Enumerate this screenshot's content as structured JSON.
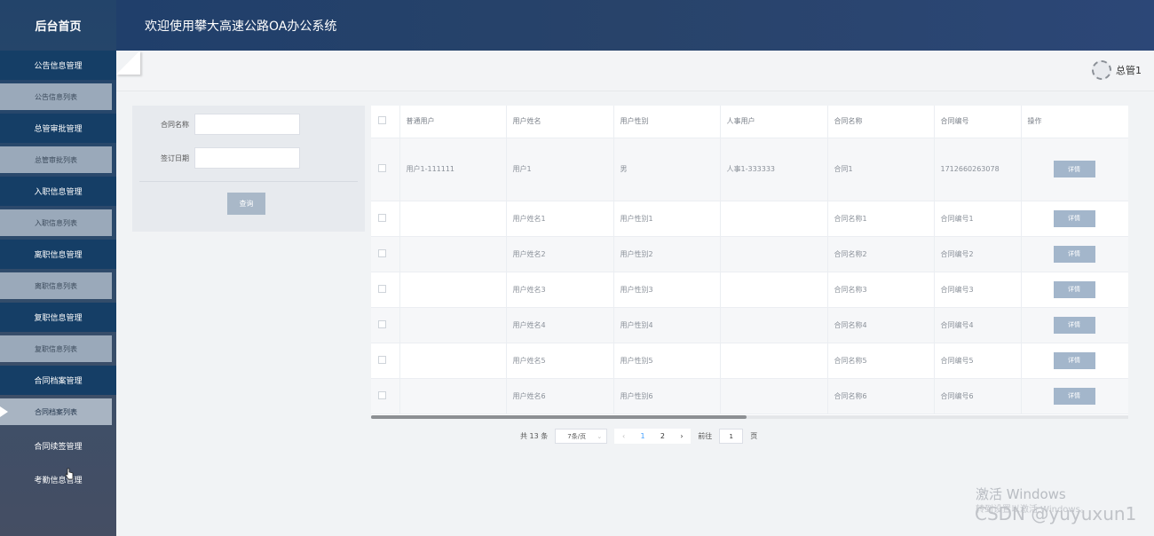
{
  "sidebar": {
    "title": "后台首页",
    "items": [
      {
        "section": "公告信息管理",
        "sub": "公告信息列表"
      },
      {
        "section": "总管审批管理",
        "sub": "总管审批列表"
      },
      {
        "section": "入职信息管理",
        "sub": "入职信息列表"
      },
      {
        "section": "离职信息管理",
        "sub": "离职信息列表"
      },
      {
        "section": "复职信息管理",
        "sub": "复职信息列表"
      },
      {
        "section": "合同档案管理",
        "sub": "合同档案列表"
      }
    ],
    "plain_items": [
      "合同续签管理",
      "考勤信息管理"
    ]
  },
  "header": {
    "title": "欢迎使用攀大高速公路OA办公系统"
  },
  "user": {
    "name": "总管1"
  },
  "search": {
    "contract_name_label": "合同名称",
    "sign_date_label": "签订日期",
    "query_button": "查询"
  },
  "table": {
    "columns": [
      "普通用户",
      "用户姓名",
      "用户性别",
      "人事用户",
      "合同名称",
      "合同编号",
      "操作"
    ],
    "rows": [
      {
        "normal_user": "用户1-111111",
        "name": "用户1",
        "gender": "男",
        "hr_user": "人事1-333333",
        "contract_name": "合同1",
        "contract_no": "1712660263078",
        "action": "详情"
      },
      {
        "normal_user": "",
        "name": "用户姓名1",
        "gender": "用户性别1",
        "hr_user": "",
        "contract_name": "合同名称1",
        "contract_no": "合同编号1",
        "action": "详情"
      },
      {
        "normal_user": "",
        "name": "用户姓名2",
        "gender": "用户性别2",
        "hr_user": "",
        "contract_name": "合同名称2",
        "contract_no": "合同编号2",
        "action": "详情"
      },
      {
        "normal_user": "",
        "name": "用户姓名3",
        "gender": "用户性别3",
        "hr_user": "",
        "contract_name": "合同名称3",
        "contract_no": "合同编号3",
        "action": "详情"
      },
      {
        "normal_user": "",
        "name": "用户姓名4",
        "gender": "用户性别4",
        "hr_user": "",
        "contract_name": "合同名称4",
        "contract_no": "合同编号4",
        "action": "详情"
      },
      {
        "normal_user": "",
        "name": "用户姓名5",
        "gender": "用户性别5",
        "hr_user": "",
        "contract_name": "合同名称5",
        "contract_no": "合同编号5",
        "action": "详情"
      },
      {
        "normal_user": "",
        "name": "用户姓名6",
        "gender": "用户性别6",
        "hr_user": "",
        "contract_name": "合同名称6",
        "contract_no": "合同编号6",
        "action": "详情"
      }
    ]
  },
  "pager": {
    "total": "共 13 条",
    "page_size": "7条/页",
    "prev": "‹",
    "pages": [
      "1",
      "2"
    ],
    "current_page": "1",
    "next": "›",
    "goto_label": "前往",
    "goto_value": "1",
    "page_suffix": "页"
  },
  "watermark": {
    "windows": "激活 Windows",
    "windows_sub": "转到设置以激活 Windows。",
    "csdn": "CSDN @yuyuxun1"
  },
  "colors": {
    "sidebar_section": "#153e66",
    "header": "#28436a",
    "detail_button": "#a3b6cb",
    "active_page": "#409eff"
  }
}
